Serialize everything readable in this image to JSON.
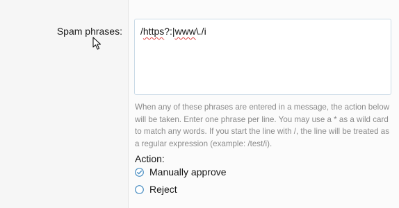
{
  "form": {
    "field_label": "Spam phrases:",
    "textarea_value": "/https?:|www\\./i",
    "textarea_value_parts": [
      "/",
      "https",
      "?:|",
      "www",
      "\\./i"
    ],
    "help_text": "When any of these phrases are entered in a message, the action below will be taken. Enter one phrase per line. You may use a * as a wild card to match any words. If you start the line with /, the line will be treated as a regular expression (example: /test/i).",
    "action_label": "Action:",
    "options": [
      {
        "label": "Manually approve",
        "selected": true
      },
      {
        "label": "Reject",
        "selected": false
      }
    ]
  },
  "icons": {
    "cursor": "mouse-pointer-icon",
    "radio_checked": "radio-checked-icon",
    "radio_unchecked": "radio-unchecked-icon"
  },
  "colors": {
    "accent": "#4a8ec2",
    "input_border": "#cbdbe7",
    "help_text": "#8a8a8a",
    "spellcheck": "#e04444"
  }
}
